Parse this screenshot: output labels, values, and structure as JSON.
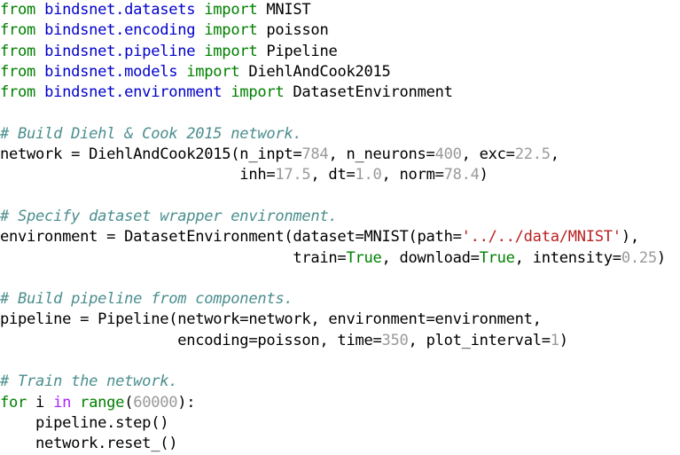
{
  "listing": {
    "language": "python",
    "background": "#ffffff",
    "colors": {
      "keyword": "#008000",
      "keyword_namespace": "#AA22FF",
      "module": "#0000CC",
      "name": "#000000",
      "builtin": "#008000",
      "constant": "#008000",
      "number": "#9a9a9a",
      "string": "#BA2121",
      "comment": "#4c8e8e"
    },
    "lines": [
      {
        "id": "line-1",
        "tokens": [
          {
            "t": "from",
            "c": "kw"
          },
          {
            "t": " ",
            "c": "punct"
          },
          {
            "t": "bindsnet.datasets",
            "c": "module"
          },
          {
            "t": " ",
            "c": "punct"
          },
          {
            "t": "import",
            "c": "kw"
          },
          {
            "t": " ",
            "c": "punct"
          },
          {
            "t": "MNIST",
            "c": "name"
          }
        ]
      },
      {
        "id": "line-2",
        "tokens": [
          {
            "t": "from",
            "c": "kw"
          },
          {
            "t": " ",
            "c": "punct"
          },
          {
            "t": "bindsnet.encoding",
            "c": "module"
          },
          {
            "t": " ",
            "c": "punct"
          },
          {
            "t": "import",
            "c": "kw"
          },
          {
            "t": " ",
            "c": "punct"
          },
          {
            "t": "poisson",
            "c": "name"
          }
        ]
      },
      {
        "id": "line-3",
        "tokens": [
          {
            "t": "from",
            "c": "kw"
          },
          {
            "t": " ",
            "c": "punct"
          },
          {
            "t": "bindsnet.pipeline",
            "c": "module"
          },
          {
            "t": " ",
            "c": "punct"
          },
          {
            "t": "import",
            "c": "kw"
          },
          {
            "t": " ",
            "c": "punct"
          },
          {
            "t": "Pipeline",
            "c": "name"
          }
        ]
      },
      {
        "id": "line-4",
        "tokens": [
          {
            "t": "from",
            "c": "kw"
          },
          {
            "t": " ",
            "c": "punct"
          },
          {
            "t": "bindsnet.models",
            "c": "module"
          },
          {
            "t": " ",
            "c": "punct"
          },
          {
            "t": "import",
            "c": "kw"
          },
          {
            "t": " ",
            "c": "punct"
          },
          {
            "t": "DiehlAndCook2015",
            "c": "name"
          }
        ]
      },
      {
        "id": "line-5",
        "tokens": [
          {
            "t": "from",
            "c": "kw"
          },
          {
            "t": " ",
            "c": "punct"
          },
          {
            "t": "bindsnet.environment",
            "c": "module"
          },
          {
            "t": " ",
            "c": "punct"
          },
          {
            "t": "import",
            "c": "kw"
          },
          {
            "t": " ",
            "c": "punct"
          },
          {
            "t": "DatasetEnvironment",
            "c": "name"
          }
        ]
      },
      {
        "id": "line-6",
        "blank": true,
        "tokens": []
      },
      {
        "id": "line-7",
        "tokens": [
          {
            "t": "# Build Diehl & Cook 2015 network.",
            "c": "comment"
          }
        ]
      },
      {
        "id": "line-8",
        "tokens": [
          {
            "t": "network = DiehlAndCook2015(n_inpt=",
            "c": "name"
          },
          {
            "t": "784",
            "c": "num"
          },
          {
            "t": ", n_neurons=",
            "c": "name"
          },
          {
            "t": "400",
            "c": "num"
          },
          {
            "t": ", exc=",
            "c": "name"
          },
          {
            "t": "22.5",
            "c": "num"
          },
          {
            "t": ",",
            "c": "punct"
          }
        ]
      },
      {
        "id": "line-9",
        "tokens": [
          {
            "t": "                           inh=",
            "c": "name"
          },
          {
            "t": "17.5",
            "c": "num"
          },
          {
            "t": ", dt=",
            "c": "name"
          },
          {
            "t": "1.0",
            "c": "num"
          },
          {
            "t": ", norm=",
            "c": "name"
          },
          {
            "t": "78.4",
            "c": "num"
          },
          {
            "t": ")",
            "c": "punct"
          }
        ]
      },
      {
        "id": "line-10",
        "blank": true,
        "tokens": []
      },
      {
        "id": "line-11",
        "tokens": [
          {
            "t": "# Specify dataset wrapper environment.",
            "c": "comment"
          }
        ]
      },
      {
        "id": "line-12",
        "tokens": [
          {
            "t": "environment = DatasetEnvironment(dataset=MNIST(path=",
            "c": "name"
          },
          {
            "t": "'../../data/MNIST'",
            "c": "str"
          },
          {
            "t": "),",
            "c": "punct"
          }
        ]
      },
      {
        "id": "line-13",
        "tokens": [
          {
            "t": "                                 train=",
            "c": "name"
          },
          {
            "t": "True",
            "c": "const"
          },
          {
            "t": ", download=",
            "c": "name"
          },
          {
            "t": "True",
            "c": "const"
          },
          {
            "t": ", intensity=",
            "c": "name"
          },
          {
            "t": "0.25",
            "c": "num"
          },
          {
            "t": ")",
            "c": "punct"
          }
        ]
      },
      {
        "id": "line-14",
        "blank": true,
        "tokens": []
      },
      {
        "id": "line-15",
        "tokens": [
          {
            "t": "# Build pipeline from components.",
            "c": "comment"
          }
        ]
      },
      {
        "id": "line-16",
        "tokens": [
          {
            "t": "pipeline = Pipeline(network=network, environment=environment,",
            "c": "name"
          }
        ]
      },
      {
        "id": "line-17",
        "tokens": [
          {
            "t": "                    encoding=poisson, time=",
            "c": "name"
          },
          {
            "t": "350",
            "c": "num"
          },
          {
            "t": ", plot_interval=",
            "c": "name"
          },
          {
            "t": "1",
            "c": "num"
          },
          {
            "t": ")",
            "c": "punct"
          }
        ]
      },
      {
        "id": "line-18",
        "blank": true,
        "tokens": []
      },
      {
        "id": "line-19",
        "tokens": [
          {
            "t": "# Train the network.",
            "c": "comment"
          }
        ]
      },
      {
        "id": "line-20",
        "tokens": [
          {
            "t": "for",
            "c": "kw"
          },
          {
            "t": " i ",
            "c": "name"
          },
          {
            "t": "in",
            "c": "kw-ns"
          },
          {
            "t": " ",
            "c": "punct"
          },
          {
            "t": "range",
            "c": "builtin"
          },
          {
            "t": "(",
            "c": "punct"
          },
          {
            "t": "60000",
            "c": "num"
          },
          {
            "t": "):",
            "c": "punct"
          }
        ]
      },
      {
        "id": "line-21",
        "tokens": [
          {
            "t": "    pipeline.step()",
            "c": "name"
          }
        ]
      },
      {
        "id": "line-22",
        "tokens": [
          {
            "t": "    network.reset_()",
            "c": "name"
          }
        ]
      }
    ]
  }
}
